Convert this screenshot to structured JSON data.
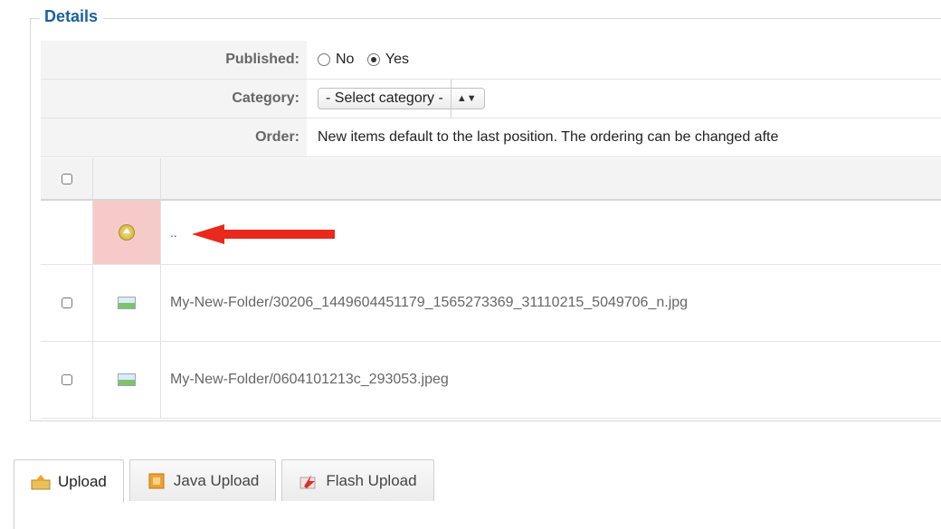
{
  "fieldset": {
    "legend": "Details"
  },
  "form": {
    "published_label": "Published:",
    "published_no": "No",
    "published_yes": "Yes",
    "category_label": "Category:",
    "category_value": "- Select category -",
    "order_label": "Order:",
    "order_text": "New items default to the last position. The ordering can be changed afte"
  },
  "grid": {
    "up_link": "..",
    "files": [
      "My-New-Folder/30206_1449604451179_1565273369_31110215_5049706_n.jpg",
      "My-New-Folder/0604101213c_293053.jpeg"
    ]
  },
  "tabs": [
    {
      "label": "Upload",
      "icon": "upload-icon"
    },
    {
      "label": "Java Upload",
      "icon": "java-upload-icon"
    },
    {
      "label": "Flash Upload",
      "icon": "flash-upload-icon"
    }
  ],
  "colors": {
    "accent": "#1e5f9e",
    "arrow": "#e8291c",
    "highlight": "#f7caca"
  }
}
